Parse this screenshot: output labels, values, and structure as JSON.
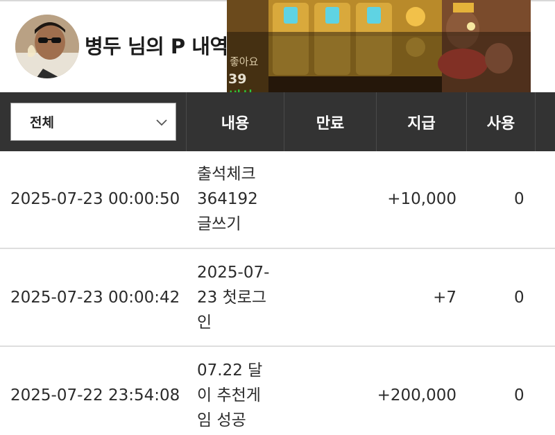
{
  "header": {
    "title": "병두 님의 P 내역"
  },
  "video_overlay": {
    "likes_label": "좋아요",
    "likes_count": "39",
    "status": "비상"
  },
  "table": {
    "filter": {
      "selected": "전체",
      "icon": "chevron-down-icon"
    },
    "columns": [
      "내용",
      "만료",
      "지급",
      "사용"
    ],
    "rows": [
      {
        "date": "2025-07-23 00:00:50",
        "content_lines": [
          "출석체크",
          "364192",
          "글쓰기"
        ],
        "expiry": "",
        "paid": "+10,000",
        "used": "0"
      },
      {
        "date": "2025-07-23 00:00:42",
        "content_lines": [
          "2025-07-",
          "23 첫로그",
          "인"
        ],
        "expiry": "",
        "paid": "+7",
        "used": "0"
      },
      {
        "date": "2025-07-22 23:54:08",
        "content_lines": [
          "07.22 달",
          "이 추천게",
          "임 성공"
        ],
        "expiry": "",
        "paid": "+200,000",
        "used": "0"
      }
    ]
  },
  "colors": {
    "header_bar": "#333333",
    "row_divider": "#dedede",
    "status_green": "#29c640"
  }
}
